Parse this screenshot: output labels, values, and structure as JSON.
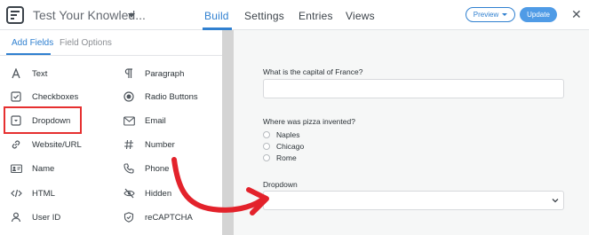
{
  "header": {
    "form_title": "Test Your Knowled...",
    "tabs": [
      {
        "label": "Build",
        "active": true
      },
      {
        "label": "Settings",
        "active": false
      },
      {
        "label": "Entries",
        "active": false
      },
      {
        "label": "Views",
        "active": false
      }
    ],
    "preview_label": "Preview",
    "update_label": "Update",
    "close_glyph": "✕"
  },
  "sidebar": {
    "tabs": [
      {
        "label": "Add Fields",
        "active": true
      },
      {
        "label": "Field Options",
        "active": false
      }
    ],
    "fields_left": [
      {
        "label": "Text",
        "icon": "text-icon"
      },
      {
        "label": "Checkboxes",
        "icon": "checkbox-icon"
      },
      {
        "label": "Dropdown",
        "icon": "dropdown-icon"
      },
      {
        "label": "Website/URL",
        "icon": "link-icon"
      },
      {
        "label": "Name",
        "icon": "name-card-icon"
      },
      {
        "label": "HTML",
        "icon": "code-icon"
      },
      {
        "label": "User ID",
        "icon": "user-icon"
      }
    ],
    "fields_right": [
      {
        "label": "Paragraph",
        "icon": "paragraph-icon"
      },
      {
        "label": "Radio Buttons",
        "icon": "radio-icon"
      },
      {
        "label": "Email",
        "icon": "envelope-icon"
      },
      {
        "label": "Number",
        "icon": "hash-icon"
      },
      {
        "label": "Phone",
        "icon": "phone-icon"
      },
      {
        "label": "Hidden",
        "icon": "eye-slash-icon"
      },
      {
        "label": "reCAPTCHA",
        "icon": "shield-icon"
      }
    ]
  },
  "form": {
    "q1_label": "What is the capital of France?",
    "q2_label": "Where was pizza invented?",
    "q2_options": [
      "Naples",
      "Chicago",
      "Rome"
    ],
    "q3_label": "Dropdown"
  },
  "colors": {
    "accent": "#3080d0",
    "highlight": "#e63030",
    "annotation_arrow": "#e3222b"
  }
}
